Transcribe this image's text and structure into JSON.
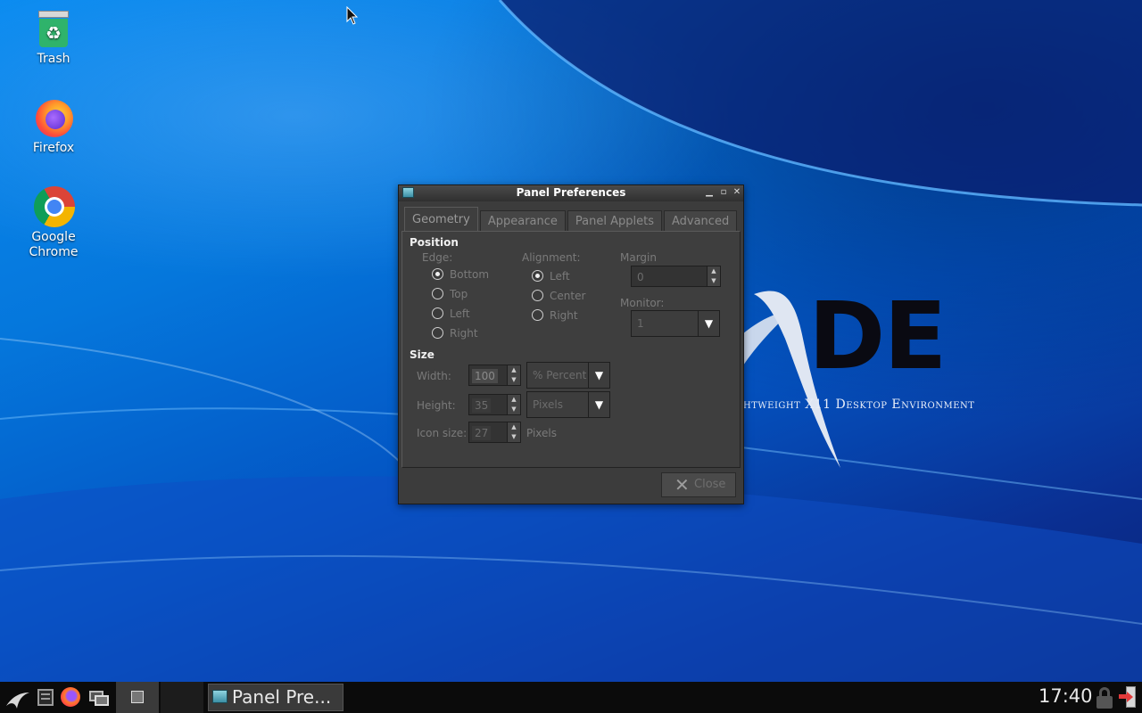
{
  "desktop": {
    "icons": [
      {
        "label": "Trash",
        "icon": "trash-icon"
      },
      {
        "label": "Firefox",
        "icon": "firefox-icon"
      },
      {
        "label": "Google Chrome",
        "icon": "chrome-icon"
      }
    ],
    "wallpaper_logo": {
      "text": "DE",
      "subtitle": "htweight X11 Desktop Environment"
    }
  },
  "window": {
    "title": "Panel Preferences",
    "tabs": [
      "Geometry",
      "Appearance",
      "Panel Applets",
      "Advanced"
    ],
    "active_tab": "Geometry",
    "position": {
      "heading": "Position",
      "edge_label": "Edge:",
      "edge_options": [
        "Bottom",
        "Top",
        "Left",
        "Right"
      ],
      "edge_selected": "Bottom",
      "alignment_label": "Alignment:",
      "alignment_options": [
        "Left",
        "Center",
        "Right"
      ],
      "alignment_selected": "Left",
      "margin_label": "Margin",
      "margin_value": "0",
      "monitor_label": "Monitor:",
      "monitor_value": "1"
    },
    "size": {
      "heading": "Size",
      "width_label": "Width:",
      "width_value": "100",
      "width_unit": "% Percent",
      "height_label": "Height:",
      "height_value": "35",
      "height_unit": "Pixels",
      "icon_size_label": "Icon size:",
      "icon_size_value": "27",
      "icon_size_unit": "Pixels"
    },
    "close_label": "Close"
  },
  "taskbar": {
    "task_label": "Panel Pre...",
    "clock": "17:40"
  },
  "colors": {
    "window_bg": "#3c3c3c",
    "taskbar_bg": "#0b0b0b",
    "desktop_blue": "#0577dc"
  }
}
